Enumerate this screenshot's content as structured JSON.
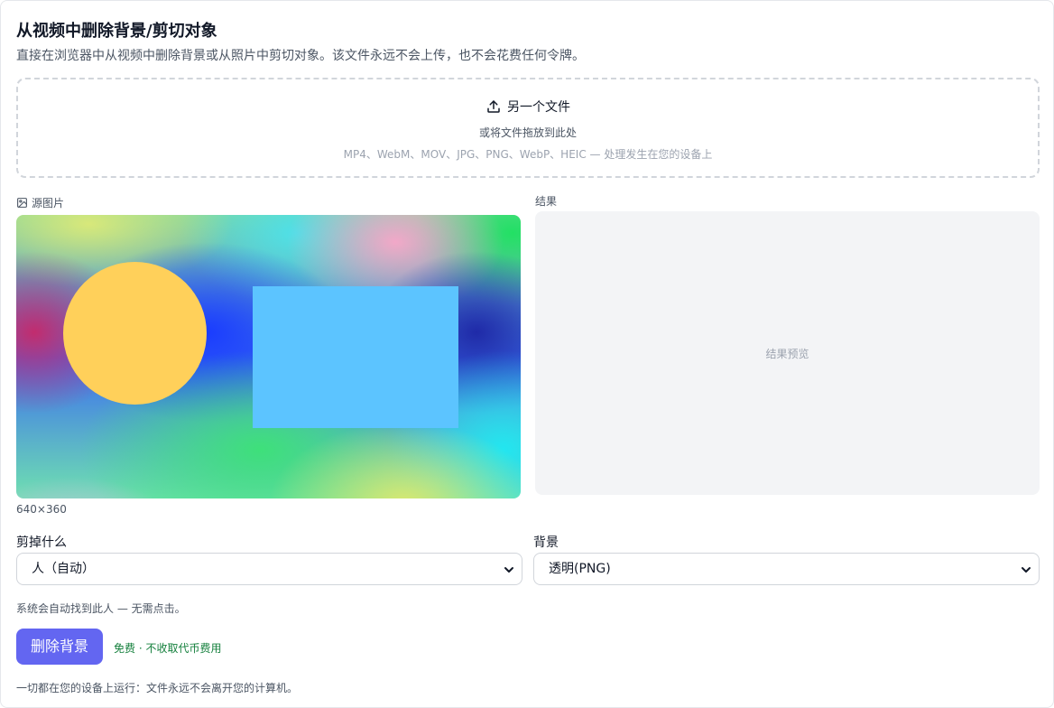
{
  "header": {
    "title": "从视频中删除背景/剪切对象",
    "subtitle": "直接在浏览器中从视频中删除背景或从照片中剪切对象。该文件永远不会上传，也不会花费任何令牌。"
  },
  "dropzone": {
    "icon": "upload-icon",
    "label": "另一个文件",
    "hint": "或将文件拖放到此处",
    "formats": "MP4、WebM、MOV、JPG、PNG、WebP、HEIC — 处理发生在您的设备上"
  },
  "source": {
    "icon": "image-icon",
    "label": "源图片",
    "dimensions": "640×360",
    "shape_colors": {
      "circle": "#ffd05a",
      "rectangle": "#5cc4ff"
    }
  },
  "result": {
    "label": "结果",
    "placeholder": "结果预览"
  },
  "controls": {
    "cut_label": "剪掉什么",
    "cut_value": "人（自动）",
    "background_label": "背景",
    "background_value": "透明(PNG)",
    "hint": "系统会自动找到此人 — 无需点击。"
  },
  "action": {
    "button_label": "删除背景",
    "free_note": "免费 · 不收取代币费用",
    "accent": "#6366f1",
    "free_color": "#15803d"
  },
  "footer": {
    "note": "一切都在您的设备上运行：文件永远不会离开您的计算机。"
  }
}
